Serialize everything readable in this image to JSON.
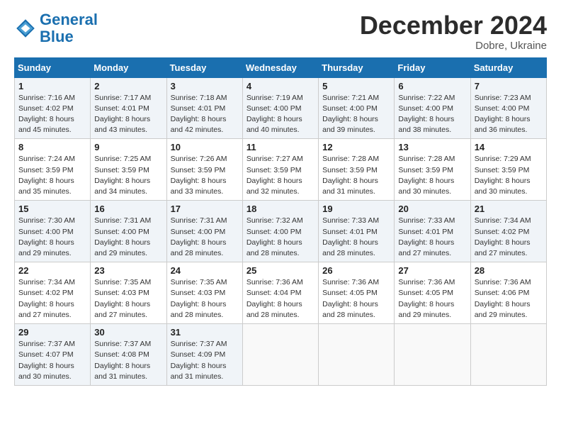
{
  "logo": {
    "line1": "General",
    "line2": "Blue"
  },
  "header": {
    "month": "December 2024",
    "location": "Dobre, Ukraine"
  },
  "weekdays": [
    "Sunday",
    "Monday",
    "Tuesday",
    "Wednesday",
    "Thursday",
    "Friday",
    "Saturday"
  ],
  "weeks": [
    [
      {
        "day": "1",
        "info": "Sunrise: 7:16 AM\nSunset: 4:02 PM\nDaylight: 8 hours\nand 45 minutes."
      },
      {
        "day": "2",
        "info": "Sunrise: 7:17 AM\nSunset: 4:01 PM\nDaylight: 8 hours\nand 43 minutes."
      },
      {
        "day": "3",
        "info": "Sunrise: 7:18 AM\nSunset: 4:01 PM\nDaylight: 8 hours\nand 42 minutes."
      },
      {
        "day": "4",
        "info": "Sunrise: 7:19 AM\nSunset: 4:00 PM\nDaylight: 8 hours\nand 40 minutes."
      },
      {
        "day": "5",
        "info": "Sunrise: 7:21 AM\nSunset: 4:00 PM\nDaylight: 8 hours\nand 39 minutes."
      },
      {
        "day": "6",
        "info": "Sunrise: 7:22 AM\nSunset: 4:00 PM\nDaylight: 8 hours\nand 38 minutes."
      },
      {
        "day": "7",
        "info": "Sunrise: 7:23 AM\nSunset: 4:00 PM\nDaylight: 8 hours\nand 36 minutes."
      }
    ],
    [
      {
        "day": "8",
        "info": "Sunrise: 7:24 AM\nSunset: 3:59 PM\nDaylight: 8 hours\nand 35 minutes."
      },
      {
        "day": "9",
        "info": "Sunrise: 7:25 AM\nSunset: 3:59 PM\nDaylight: 8 hours\nand 34 minutes."
      },
      {
        "day": "10",
        "info": "Sunrise: 7:26 AM\nSunset: 3:59 PM\nDaylight: 8 hours\nand 33 minutes."
      },
      {
        "day": "11",
        "info": "Sunrise: 7:27 AM\nSunset: 3:59 PM\nDaylight: 8 hours\nand 32 minutes."
      },
      {
        "day": "12",
        "info": "Sunrise: 7:28 AM\nSunset: 3:59 PM\nDaylight: 8 hours\nand 31 minutes."
      },
      {
        "day": "13",
        "info": "Sunrise: 7:28 AM\nSunset: 3:59 PM\nDaylight: 8 hours\nand 30 minutes."
      },
      {
        "day": "14",
        "info": "Sunrise: 7:29 AM\nSunset: 3:59 PM\nDaylight: 8 hours\nand 30 minutes."
      }
    ],
    [
      {
        "day": "15",
        "info": "Sunrise: 7:30 AM\nSunset: 4:00 PM\nDaylight: 8 hours\nand 29 minutes."
      },
      {
        "day": "16",
        "info": "Sunrise: 7:31 AM\nSunset: 4:00 PM\nDaylight: 8 hours\nand 29 minutes."
      },
      {
        "day": "17",
        "info": "Sunrise: 7:31 AM\nSunset: 4:00 PM\nDaylight: 8 hours\nand 28 minutes."
      },
      {
        "day": "18",
        "info": "Sunrise: 7:32 AM\nSunset: 4:00 PM\nDaylight: 8 hours\nand 28 minutes."
      },
      {
        "day": "19",
        "info": "Sunrise: 7:33 AM\nSunset: 4:01 PM\nDaylight: 8 hours\nand 28 minutes."
      },
      {
        "day": "20",
        "info": "Sunrise: 7:33 AM\nSunset: 4:01 PM\nDaylight: 8 hours\nand 27 minutes."
      },
      {
        "day": "21",
        "info": "Sunrise: 7:34 AM\nSunset: 4:02 PM\nDaylight: 8 hours\nand 27 minutes."
      }
    ],
    [
      {
        "day": "22",
        "info": "Sunrise: 7:34 AM\nSunset: 4:02 PM\nDaylight: 8 hours\nand 27 minutes."
      },
      {
        "day": "23",
        "info": "Sunrise: 7:35 AM\nSunset: 4:03 PM\nDaylight: 8 hours\nand 27 minutes."
      },
      {
        "day": "24",
        "info": "Sunrise: 7:35 AM\nSunset: 4:03 PM\nDaylight: 8 hours\nand 28 minutes."
      },
      {
        "day": "25",
        "info": "Sunrise: 7:36 AM\nSunset: 4:04 PM\nDaylight: 8 hours\nand 28 minutes."
      },
      {
        "day": "26",
        "info": "Sunrise: 7:36 AM\nSunset: 4:05 PM\nDaylight: 8 hours\nand 28 minutes."
      },
      {
        "day": "27",
        "info": "Sunrise: 7:36 AM\nSunset: 4:05 PM\nDaylight: 8 hours\nand 29 minutes."
      },
      {
        "day": "28",
        "info": "Sunrise: 7:36 AM\nSunset: 4:06 PM\nDaylight: 8 hours\nand 29 minutes."
      }
    ],
    [
      {
        "day": "29",
        "info": "Sunrise: 7:37 AM\nSunset: 4:07 PM\nDaylight: 8 hours\nand 30 minutes."
      },
      {
        "day": "30",
        "info": "Sunrise: 7:37 AM\nSunset: 4:08 PM\nDaylight: 8 hours\nand 31 minutes."
      },
      {
        "day": "31",
        "info": "Sunrise: 7:37 AM\nSunset: 4:09 PM\nDaylight: 8 hours\nand 31 minutes."
      },
      {
        "day": "",
        "info": ""
      },
      {
        "day": "",
        "info": ""
      },
      {
        "day": "",
        "info": ""
      },
      {
        "day": "",
        "info": ""
      }
    ]
  ]
}
